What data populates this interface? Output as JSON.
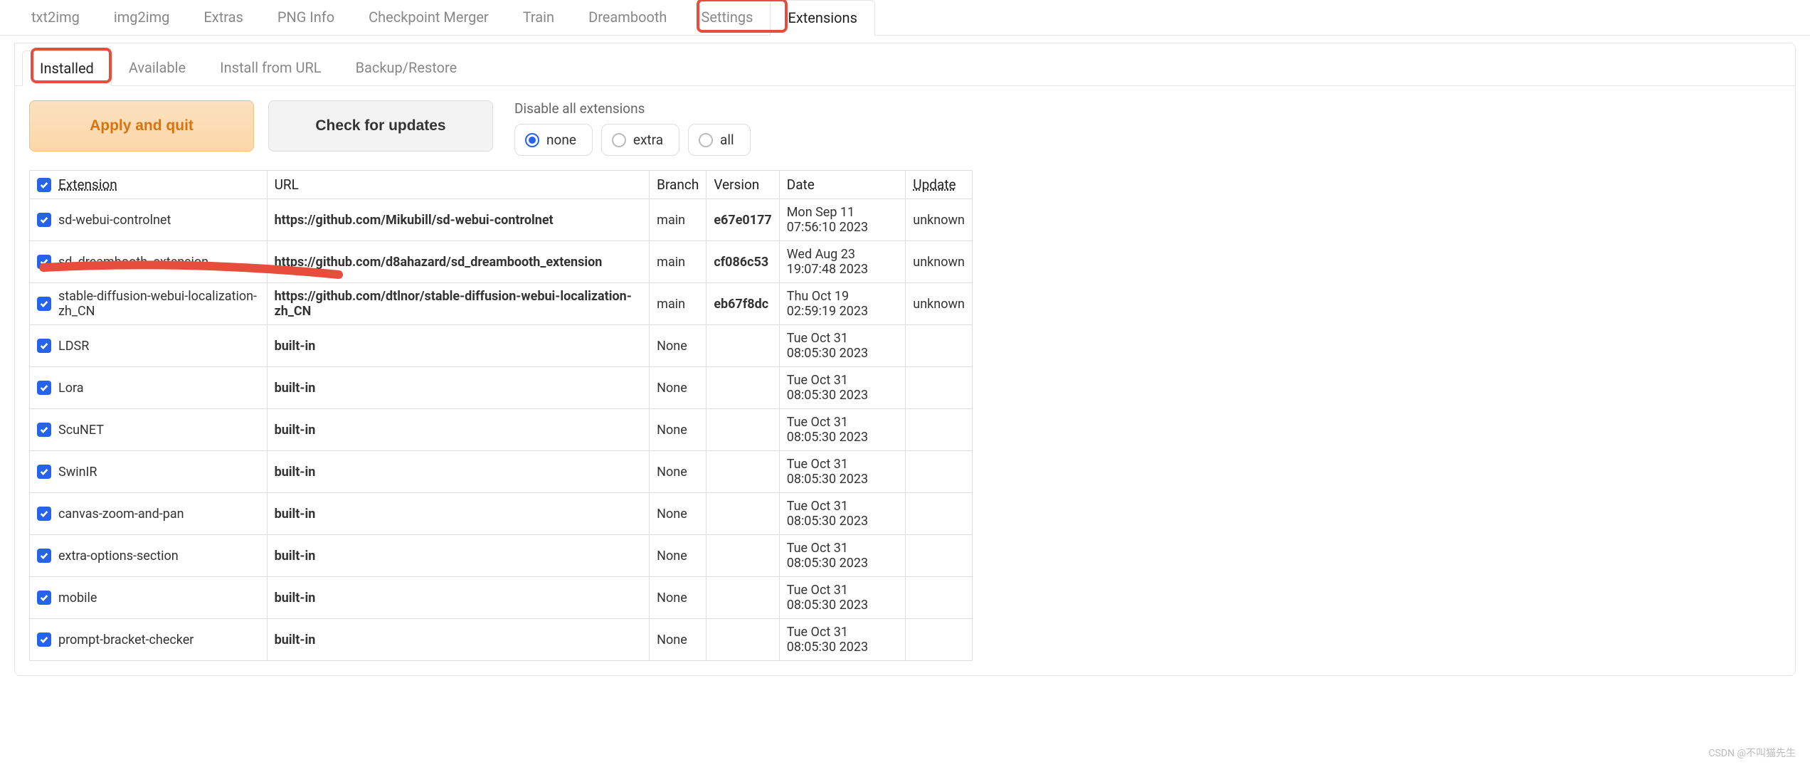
{
  "main_tabs": {
    "items": [
      "txt2img",
      "img2img",
      "Extras",
      "PNG Info",
      "Checkpoint Merger",
      "Train",
      "Dreambooth",
      "Settings",
      "Extensions"
    ],
    "active": "Extensions"
  },
  "sub_tabs": {
    "items": [
      "Installed",
      "Available",
      "Install from URL",
      "Backup/Restore"
    ],
    "active": "Installed"
  },
  "buttons": {
    "apply": "Apply and quit",
    "check": "Check for updates"
  },
  "disable": {
    "label": "Disable all extensions",
    "options": [
      "none",
      "extra",
      "all"
    ],
    "selected": "none"
  },
  "table": {
    "headers": {
      "extension": "Extension",
      "url": "URL",
      "branch": "Branch",
      "version": "Version",
      "date": "Date",
      "update": "Update"
    },
    "rows": [
      {
        "checked": true,
        "name": "sd-webui-controlnet",
        "url": "https://github.com/Mikubill/sd-webui-controlnet",
        "url_bold": true,
        "branch": "main",
        "version": "e67e0177",
        "date": "Mon Sep 11 07:56:10 2023",
        "update": "unknown"
      },
      {
        "checked": true,
        "name": "sd_dreambooth_extension",
        "url": "https://github.com/d8ahazard/sd_dreambooth_extension",
        "url_bold": true,
        "branch": "main",
        "version": "cf086c53",
        "date": "Wed Aug 23 19:07:48 2023",
        "update": "unknown"
      },
      {
        "checked": true,
        "name": "stable-diffusion-webui-localization-zh_CN",
        "url": "https://github.com/dtlnor/stable-diffusion-webui-localization-zh_CN",
        "url_bold": true,
        "branch": "main",
        "version": "eb67f8dc",
        "date": "Thu Oct 19 02:59:19 2023",
        "update": "unknown"
      },
      {
        "checked": true,
        "name": "LDSR",
        "url": "built-in",
        "url_bold": true,
        "branch": "None",
        "version": "",
        "date": "Tue Oct 31 08:05:30 2023",
        "update": ""
      },
      {
        "checked": true,
        "name": "Lora",
        "url": "built-in",
        "url_bold": true,
        "branch": "None",
        "version": "",
        "date": "Tue Oct 31 08:05:30 2023",
        "update": ""
      },
      {
        "checked": true,
        "name": "ScuNET",
        "url": "built-in",
        "url_bold": true,
        "branch": "None",
        "version": "",
        "date": "Tue Oct 31 08:05:30 2023",
        "update": ""
      },
      {
        "checked": true,
        "name": "SwinIR",
        "url": "built-in",
        "url_bold": true,
        "branch": "None",
        "version": "",
        "date": "Tue Oct 31 08:05:30 2023",
        "update": ""
      },
      {
        "checked": true,
        "name": "canvas-zoom-and-pan",
        "url": "built-in",
        "url_bold": true,
        "branch": "None",
        "version": "",
        "date": "Tue Oct 31 08:05:30 2023",
        "update": ""
      },
      {
        "checked": true,
        "name": "extra-options-section",
        "url": "built-in",
        "url_bold": true,
        "branch": "None",
        "version": "",
        "date": "Tue Oct 31 08:05:30 2023",
        "update": ""
      },
      {
        "checked": true,
        "name": "mobile",
        "url": "built-in",
        "url_bold": true,
        "branch": "None",
        "version": "",
        "date": "Tue Oct 31 08:05:30 2023",
        "update": ""
      },
      {
        "checked": true,
        "name": "prompt-bracket-checker",
        "url": "built-in",
        "url_bold": true,
        "branch": "None",
        "version": "",
        "date": "Tue Oct 31 08:05:30 2023",
        "update": ""
      }
    ]
  },
  "watermark": "CSDN @不叫猫先生"
}
